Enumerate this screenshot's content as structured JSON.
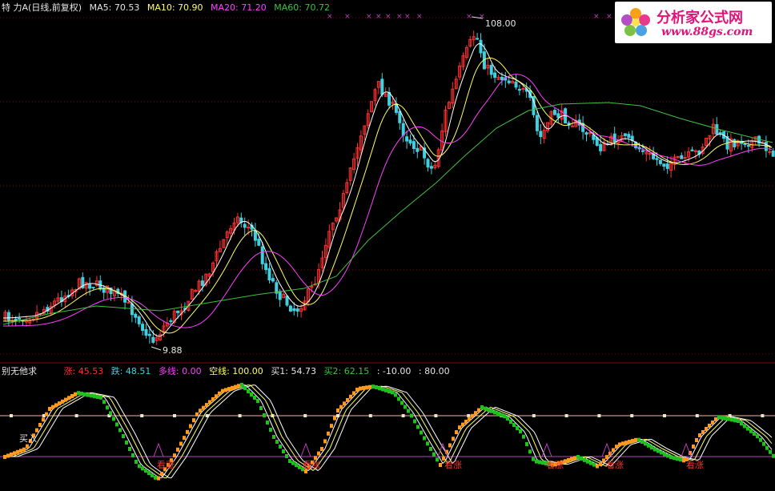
{
  "header": {
    "stock_name": "特  力A(日线,前复权)",
    "ma5": "MA5: 70.53",
    "ma10": "MA10: 70.90",
    "ma20": "MA20: 71.20",
    "ma60": "MA60: 70.72"
  },
  "indicator_header": {
    "name": "别无他求",
    "rise": "涨: 45.53",
    "fall": "跌: 48.51",
    "long_line": "多线: 0.00",
    "short_line": "空线: 100.00",
    "buy1": "买1: 54.73",
    "buy2": "买2: 62.15",
    "level_low": ": -10.00",
    "level_high": ": 80.00"
  },
  "price_chart": {
    "high_label": "108.00",
    "low_label": "9.88"
  },
  "indicator_chart": {
    "buy_label": "买入",
    "signal_label": "看涨",
    "signal_count": 7
  },
  "watermark": {
    "title": "分析家公式网",
    "url": "www.88gs.com"
  },
  "colors": {
    "ma5": "#ffffff",
    "ma10": "#ffff66",
    "ma20": "#ff40ff",
    "ma60": "#40c040",
    "up_candle": "#ff3030",
    "down_candle": "#40d0e0",
    "indicator_up": "#ff9a20",
    "indicator_down": "#20c020",
    "grid": "#8b0000"
  }
}
